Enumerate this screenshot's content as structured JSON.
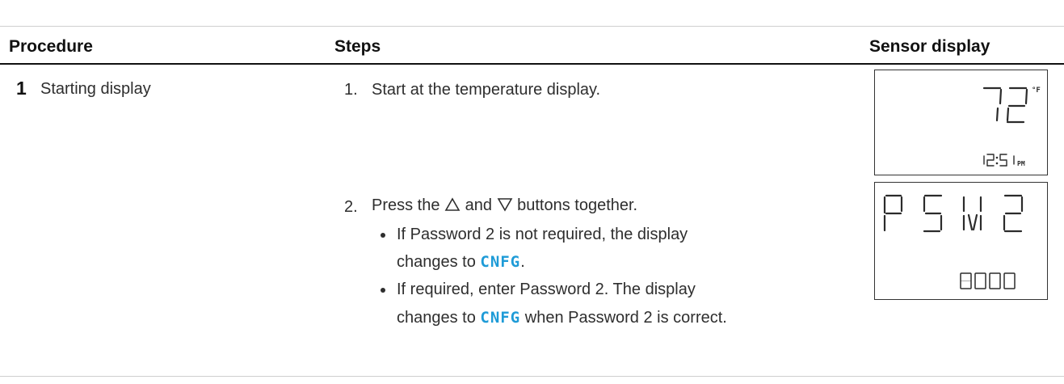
{
  "headers": {
    "procedure": "Procedure",
    "steps": "Steps",
    "sensor_display": "Sensor display"
  },
  "row": {
    "number": "1",
    "title": "Starting display",
    "step1": {
      "num": "1.",
      "text": "Start at the temperature display."
    },
    "step2": {
      "num": "2.",
      "text_prefix": "Press the",
      "text_and": "and",
      "text_suffix": "buttons together.",
      "bullets": [
        {
          "line1": "If Password 2 is not required, the display",
          "line2_prefix": "changes to",
          "line2_code": "CNFG",
          "line2_suffix": "."
        },
        {
          "line1": "If required, enter Password 2. The display",
          "line2_prefix": "changes to",
          "line2_code": "CNFG",
          "line2_suffix": "when Password 2 is correct."
        }
      ]
    }
  },
  "displays": {
    "first": {
      "main": "72",
      "unit": "°F",
      "time": "12:51",
      "ampm": "PM"
    },
    "second": {
      "main": "PSW2",
      "sub": "0000"
    }
  },
  "icons": {
    "up": "up-triangle-icon",
    "down": "down-triangle-icon"
  },
  "colors": {
    "code_text": "#1e9bd7",
    "header_rule": "#111111"
  }
}
